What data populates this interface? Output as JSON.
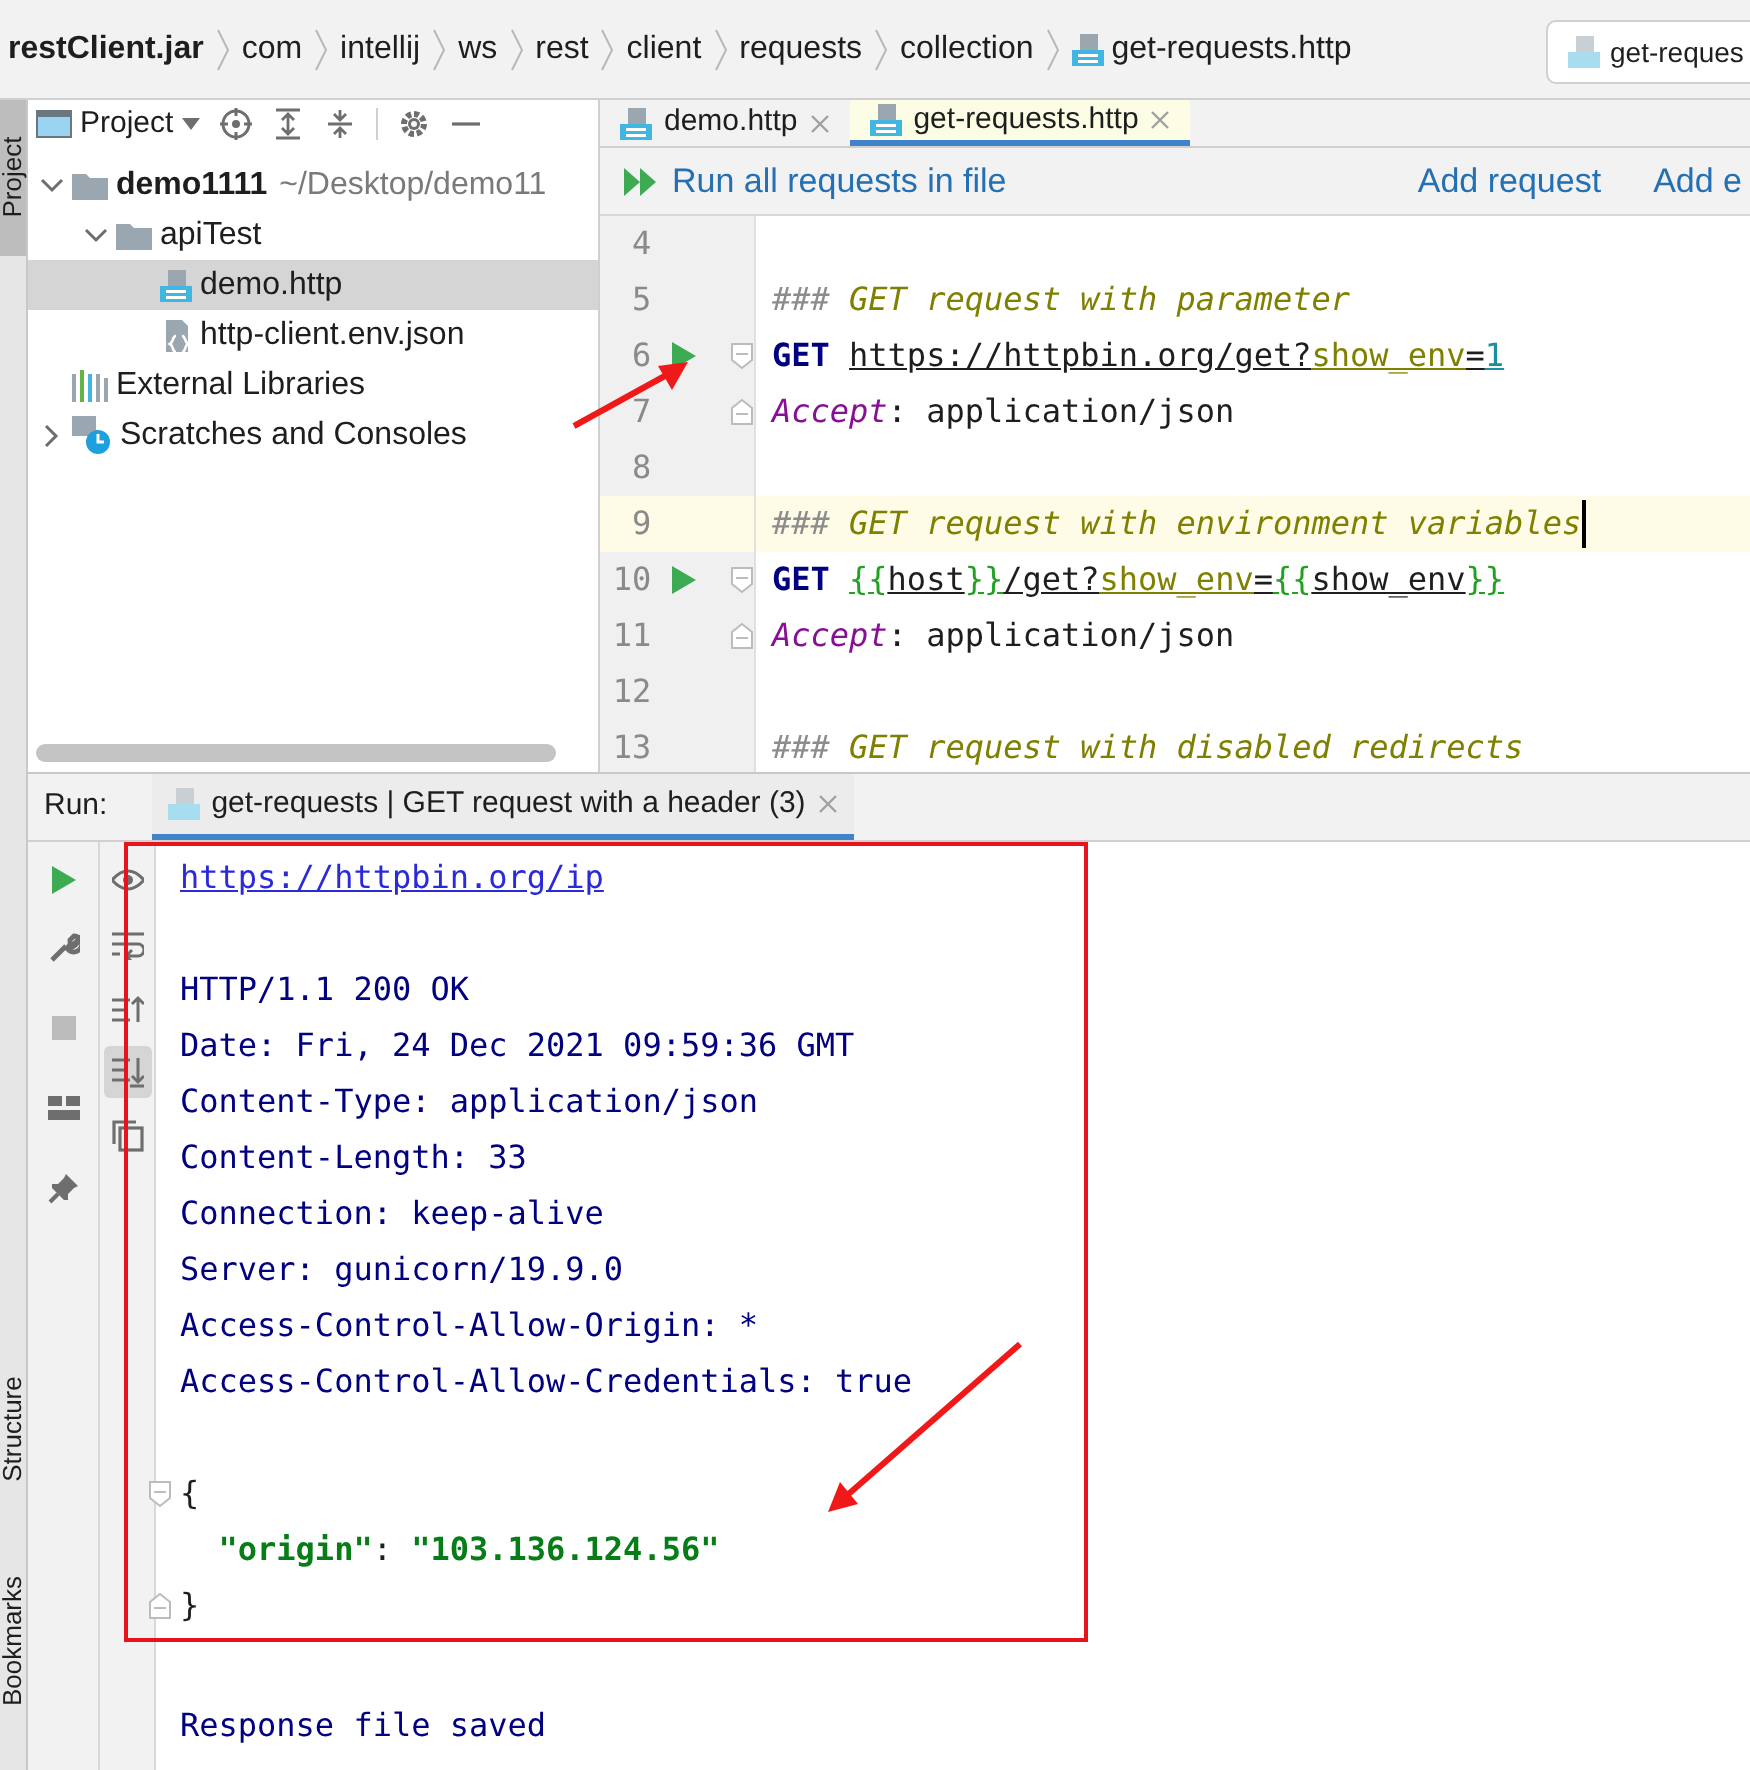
{
  "breadcrumbs": [
    {
      "label": "restClient.jar",
      "kind": "jar"
    },
    {
      "label": "com",
      "kind": "package"
    },
    {
      "label": "intellij",
      "kind": "package"
    },
    {
      "label": "ws",
      "kind": "package"
    },
    {
      "label": "rest",
      "kind": "package"
    },
    {
      "label": "client",
      "kind": "package"
    },
    {
      "label": "requests",
      "kind": "package"
    },
    {
      "label": "collection",
      "kind": "package"
    },
    {
      "label": "get-requests.http",
      "kind": "http-file"
    }
  ],
  "navigation_field": {
    "value": "get-reques"
  },
  "tool_strip": [
    {
      "label": "Project",
      "selected": true
    },
    {
      "label": "Structure",
      "selected": false
    },
    {
      "label": "Bookmarks",
      "selected": false
    }
  ],
  "project_panel": {
    "view_selector": "Project",
    "tree": [
      {
        "label": "demo1111",
        "path": "~/Desktop/demo11",
        "kind": "folder",
        "expanded": true,
        "selected": false,
        "children": [
          {
            "label": "apiTest",
            "kind": "folder",
            "expanded": true,
            "selected": false,
            "children": [
              {
                "label": "demo.http",
                "kind": "http-file",
                "selected": true
              },
              {
                "label": "http-client.env.json",
                "kind": "json-file",
                "selected": false
              }
            ]
          }
        ]
      },
      {
        "label": "External Libraries",
        "kind": "libraries",
        "selected": false
      },
      {
        "label": "Scratches and Consoles",
        "kind": "scratches",
        "expanded": false,
        "selected": false
      }
    ]
  },
  "editor_tabs": [
    {
      "label": "demo.http",
      "selected": false
    },
    {
      "label": "get-requests.http",
      "selected": true
    }
  ],
  "editor_toolbar": {
    "run_all": "Run all requests in file",
    "actions": [
      "Add request",
      "Add e"
    ]
  },
  "editor": {
    "lines": [
      {
        "number": "4",
        "kind": "plain",
        "run": false,
        "current": false
      },
      {
        "number": "5",
        "kind": "plain",
        "run": false,
        "current": false,
        "tokens": [
          {
            "text": "###",
            "kind": "hash"
          },
          {
            "text": " GET request with parameter",
            "kind": "comment"
          }
        ]
      },
      {
        "number": "6",
        "kind": "fold-start",
        "run": true,
        "current": false,
        "tokens": [
          {
            "text": "GET ",
            "kind": "method"
          },
          {
            "text": "https://httpbin.org/get?",
            "kind": "url"
          },
          {
            "text": "show_env",
            "kind": "url-param"
          },
          {
            "text": "=",
            "kind": "url"
          },
          {
            "text": "1",
            "kind": "url-value"
          }
        ]
      },
      {
        "number": "7",
        "kind": "fold-end",
        "run": false,
        "current": false,
        "tokens": [
          {
            "text": "Accept",
            "kind": "header"
          },
          {
            "text": ": application/json",
            "kind": "plain"
          }
        ]
      },
      {
        "number": "8",
        "kind": "plain",
        "run": false,
        "current": false
      },
      {
        "number": "9",
        "kind": "plain",
        "run": false,
        "current": true,
        "tokens": [
          {
            "text": "###",
            "kind": "hash"
          },
          {
            "text": " GET request with environment variables",
            "kind": "comment"
          }
        ]
      },
      {
        "number": "10",
        "kind": "fold-start",
        "run": true,
        "current": false,
        "tokens": [
          {
            "text": "GET ",
            "kind": "method"
          },
          {
            "text": "{{",
            "kind": "url-brace"
          },
          {
            "text": "host",
            "kind": "url"
          },
          {
            "text": "}}",
            "kind": "url-brace"
          },
          {
            "text": "/get?",
            "kind": "url"
          },
          {
            "text": "show_env",
            "kind": "url-param"
          },
          {
            "text": "=",
            "kind": "url"
          },
          {
            "text": "{{",
            "kind": "url-brace"
          },
          {
            "text": "show_env",
            "kind": "url"
          },
          {
            "text": "}}",
            "kind": "url-brace"
          }
        ]
      },
      {
        "number": "11",
        "kind": "fold-end",
        "run": false,
        "current": false,
        "tokens": [
          {
            "text": "Accept",
            "kind": "header"
          },
          {
            "text": ": application/json",
            "kind": "plain"
          }
        ]
      },
      {
        "number": "12",
        "kind": "plain",
        "run": false,
        "current": false
      },
      {
        "number": "13",
        "kind": "plain",
        "run": false,
        "current": false,
        "tokens": [
          {
            "text": "###",
            "kind": "hash"
          },
          {
            "text": " GET request with disabled redirects",
            "kind": "comment"
          }
        ]
      }
    ]
  },
  "run_panel": {
    "label": "Run:",
    "tab": {
      "label": "get-requests | GET request with a header (3)",
      "selected": true
    },
    "tools": [
      {
        "kind": "run",
        "disabled": false
      },
      {
        "kind": "wrench",
        "disabled": false
      },
      {
        "kind": "stop",
        "disabled": true
      },
      {
        "kind": "layout",
        "disabled": false
      },
      {
        "kind": "pin",
        "disabled": false
      }
    ],
    "view_tools": [
      {
        "kind": "eye",
        "selected": false
      },
      {
        "kind": "wrap",
        "selected": false
      },
      {
        "kind": "scroll-up",
        "selected": false
      },
      {
        "kind": "scroll-down",
        "selected": true
      },
      {
        "kind": "copy",
        "selected": false
      }
    ],
    "framed_output": [
      {
        "kind": "text",
        "tokens": [
          {
            "text": "https://httpbin.org/ip",
            "kind": "link"
          }
        ]
      },
      {
        "kind": "blank"
      },
      {
        "kind": "text",
        "tokens": [
          {
            "text": "HTTP/1.1 200 OK",
            "kind": "response"
          }
        ]
      },
      {
        "kind": "text",
        "tokens": [
          {
            "text": "Date: Fri, 24 Dec 2021 09:59:36 GMT",
            "kind": "response"
          }
        ]
      },
      {
        "kind": "text",
        "tokens": [
          {
            "text": "Content-Type: application/json",
            "kind": "response"
          }
        ]
      },
      {
        "kind": "text",
        "tokens": [
          {
            "text": "Content-Length: 33",
            "kind": "response"
          }
        ]
      },
      {
        "kind": "text",
        "tokens": [
          {
            "text": "Connection: keep-alive",
            "kind": "response"
          }
        ]
      },
      {
        "kind": "text",
        "tokens": [
          {
            "text": "Server: gunicorn/19.9.0",
            "kind": "response"
          }
        ]
      },
      {
        "kind": "text",
        "tokens": [
          {
            "text": "Access-Control-Allow-Origin: *",
            "kind": "response"
          }
        ]
      },
      {
        "kind": "text",
        "tokens": [
          {
            "text": "Access-Control-Allow-Credentials: true",
            "kind": "response"
          }
        ]
      },
      {
        "kind": "blank"
      },
      {
        "kind": "fold-start",
        "tokens": [
          {
            "text": "{",
            "kind": "plain"
          }
        ]
      },
      {
        "kind": "text",
        "tokens": [
          {
            "text": "  \"origin\"",
            "kind": "json-string"
          },
          {
            "text": ": ",
            "kind": "plain"
          },
          {
            "text": "\"103.136.124.56\"",
            "kind": "json-string"
          }
        ]
      },
      {
        "kind": "fold-end",
        "tokens": [
          {
            "text": "}",
            "kind": "plain"
          }
        ]
      }
    ],
    "output": [
      {
        "kind": "blank"
      },
      {
        "kind": "text",
        "tokens": [
          {
            "text": "Response file saved",
            "kind": "response"
          }
        ]
      }
    ]
  }
}
